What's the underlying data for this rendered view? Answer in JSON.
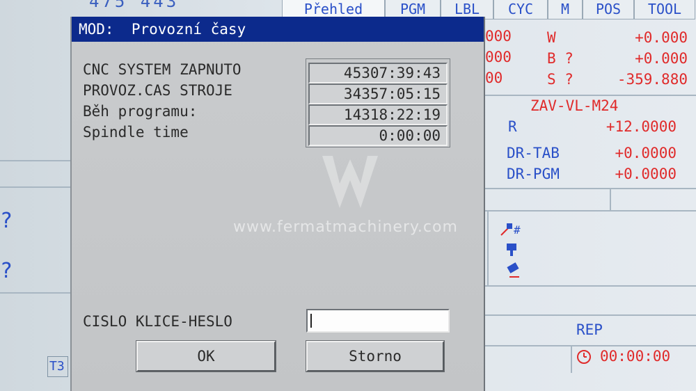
{
  "background": {
    "top_partial": "475 443",
    "tabs": [
      "Přehled",
      "PGM",
      "LBL",
      "CYC",
      "M",
      "POS",
      "TOOL"
    ],
    "right_panel": {
      "partial_values": [
        "000",
        "000",
        "00"
      ],
      "axes": [
        {
          "label": "W",
          "value": "+0.000"
        },
        {
          "label": "B ?",
          "value": "+0.000"
        },
        {
          "label": "S ?",
          "value": "-359.880"
        }
      ],
      "tool_name": "ZAV-VL-M24",
      "r": {
        "label": "R",
        "value": "+12.0000"
      },
      "dr_tab": {
        "label": "DR-TAB",
        "value": "+0.0000"
      },
      "dr_pgm": {
        "label": "DR-PGM",
        "value": "+0.0000"
      },
      "rep_label": "REP",
      "timer": "00:00:00"
    },
    "left_marks": [
      "?",
      "?"
    ],
    "bottom_left": "T3"
  },
  "dialog": {
    "title": "MOD:  Provozní časy",
    "rows": [
      {
        "label": "CNC SYSTEM ZAPNUTO",
        "value": "45307:39:43"
      },
      {
        "label": "PROVOZ.CAS STROJE",
        "value": "34357:05:15"
      },
      {
        "label": "Běh programu:",
        "value": "14318:22:19"
      },
      {
        "label": "Spindle time",
        "value": "0:00:00"
      }
    ],
    "password_label": "CISLO KLICE-HESLO",
    "password_value": "",
    "ok_label": "OK",
    "cancel_label": "Storno"
  },
  "watermark": "www.fermatmachinery.com"
}
